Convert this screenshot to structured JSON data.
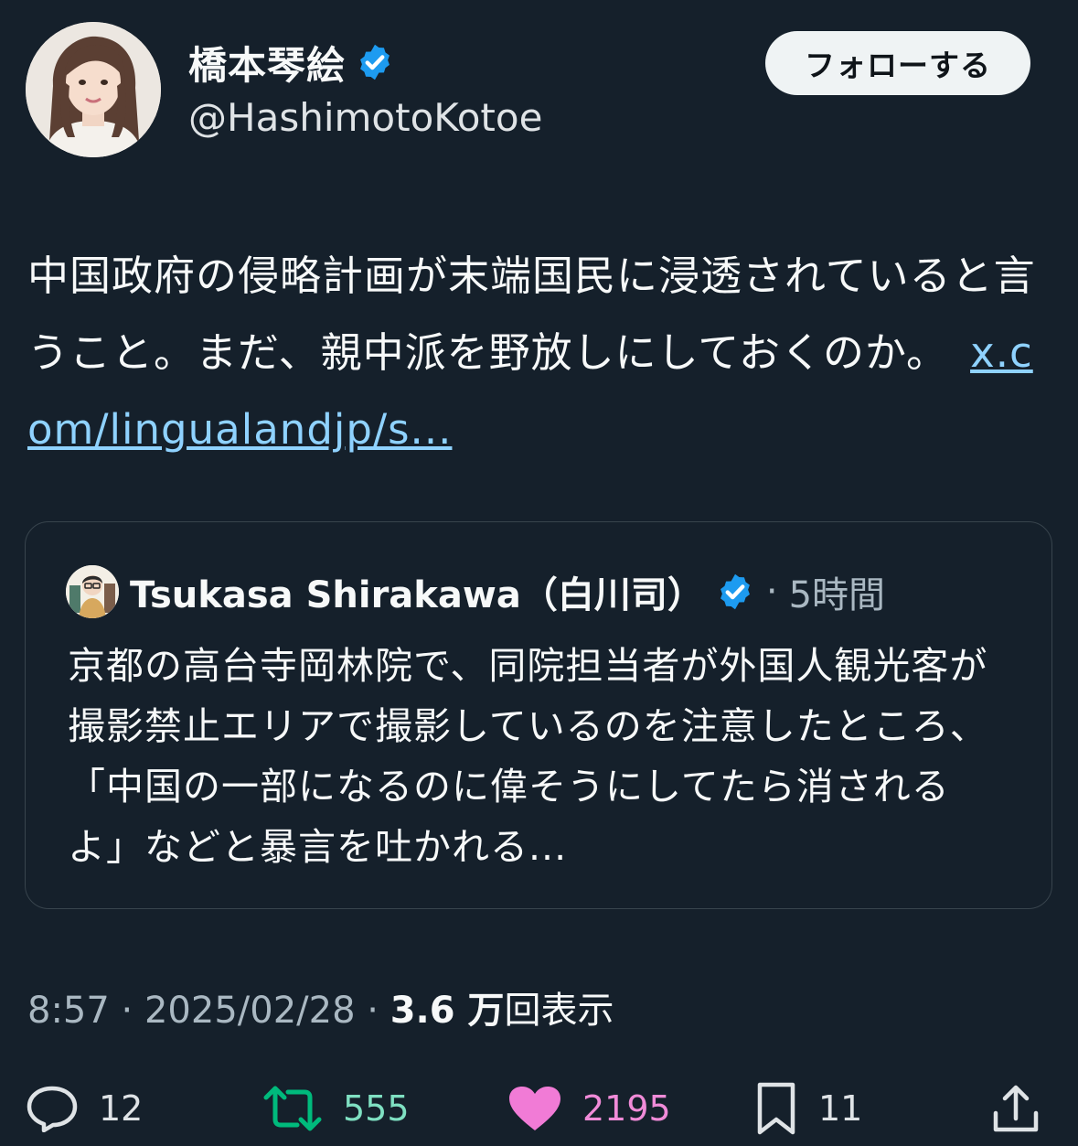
{
  "author": {
    "display_name": "橋本琴絵",
    "handle": "@HashimotoKotoe",
    "verified": true,
    "follow_label": "フォローする"
  },
  "tweet": {
    "text": "中国政府の侵略計画が末端国民に浸透されていると言うこと。まだ、親中派を野放しにしておくのか。",
    "link_text": "x.com/lingualandjp/s..."
  },
  "quote": {
    "name": "Tsukasa Shirakawa（白川司）",
    "verified": true,
    "separator": "·",
    "time": "5時間",
    "text": "京都の高台寺岡林院で、同院担当者が外国人観光客が撮影禁止エリアで撮影しているのを注意したところ、「中国の一部になるのに偉そうにしてたら消されるよ」などと暴言を吐かれる..."
  },
  "meta": {
    "time": "8:57",
    "separator": "·",
    "date": "2025/02/28",
    "views_count": "3.6 万",
    "views_label": "回表示"
  },
  "actions": {
    "replies": "12",
    "retweets": "555",
    "likes": "2195",
    "bookmarks": "11"
  },
  "colors": {
    "background": "#15202b",
    "link": "#8fd2ff",
    "verified": "#1d9bf0",
    "retweet": "#00ba7c",
    "like": "#f91880"
  },
  "icons": {
    "verified": "verified-badge-icon",
    "reply": "speech-bubble-icon",
    "retweet": "retweet-arrows-icon",
    "like": "heart-filled-icon",
    "bookmark": "bookmark-icon",
    "share": "share-upload-icon"
  }
}
